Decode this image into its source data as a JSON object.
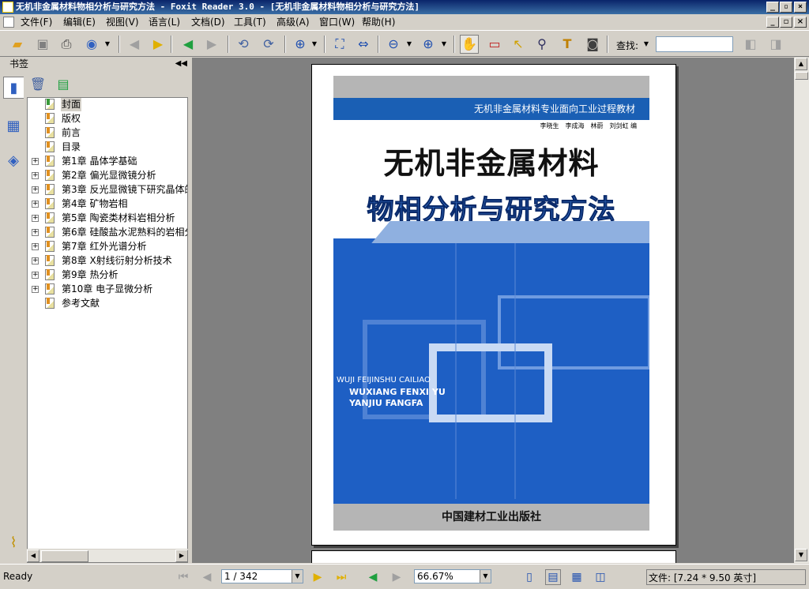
{
  "window": {
    "title": "无机非金属材料物相分析与研究方法 - Foxit Reader 3.0 - [无机非金属材料物相分析与研究方法]"
  },
  "menu": {
    "items": [
      "文件(F)",
      "编辑(E)",
      "视图(V)",
      "语言(L)",
      "文档(D)",
      "工具(T)",
      "高级(A)",
      "窗口(W)",
      "帮助(H)"
    ]
  },
  "toolbar": {
    "find_label": "查找:",
    "find_value": ""
  },
  "bookmarks": {
    "pane_title": "书签",
    "items": [
      {
        "label": "封面",
        "expandable": false,
        "selected": true
      },
      {
        "label": "版权",
        "expandable": false
      },
      {
        "label": "前言",
        "expandable": false
      },
      {
        "label": "目录",
        "expandable": false
      },
      {
        "label": "第1章 晶体学基础",
        "expandable": true
      },
      {
        "label": "第2章 偏光显微镜分析",
        "expandable": true
      },
      {
        "label": "第3章 反光显微镜下研究晶体的",
        "expandable": true
      },
      {
        "label": "第4章 矿物岩相",
        "expandable": true
      },
      {
        "label": "第5章 陶瓷类材料岩相分析",
        "expandable": true
      },
      {
        "label": "第6章 硅酸盐水泥熟料的岩相分",
        "expandable": true
      },
      {
        "label": "第7章 红外光谱分析",
        "expandable": true
      },
      {
        "label": "第8章 X射线衍射分析技术",
        "expandable": true
      },
      {
        "label": "第9章 热分析",
        "expandable": true
      },
      {
        "label": "第10章 电子显微分析",
        "expandable": true
      },
      {
        "label": "参考文献",
        "expandable": false
      }
    ]
  },
  "cover": {
    "series": "无机非金属材料专业面向工业过程教材",
    "authors": "李晓生　李成海　林蔚　刘剑虹 编",
    "title_line1": "无机非金属材料",
    "title_line2": "物相分析与研究方法",
    "pinyin1": "WUJI FEIJINSHU CAILIAO",
    "pinyin2": "WUXIANG FENXI YU",
    "pinyin3": "YANJIU FANGFA",
    "publisher": "中国建材工业出版社"
  },
  "status": {
    "ready": "Ready",
    "page": "1 / 342",
    "zoom": "66.67%",
    "file_info": "文件: [7.24 * 9.50 英寸]"
  },
  "colors": {
    "titlebar": "#0a246a",
    "cover_blue": "#1e5fc4",
    "viewer_bg": "#808080"
  }
}
